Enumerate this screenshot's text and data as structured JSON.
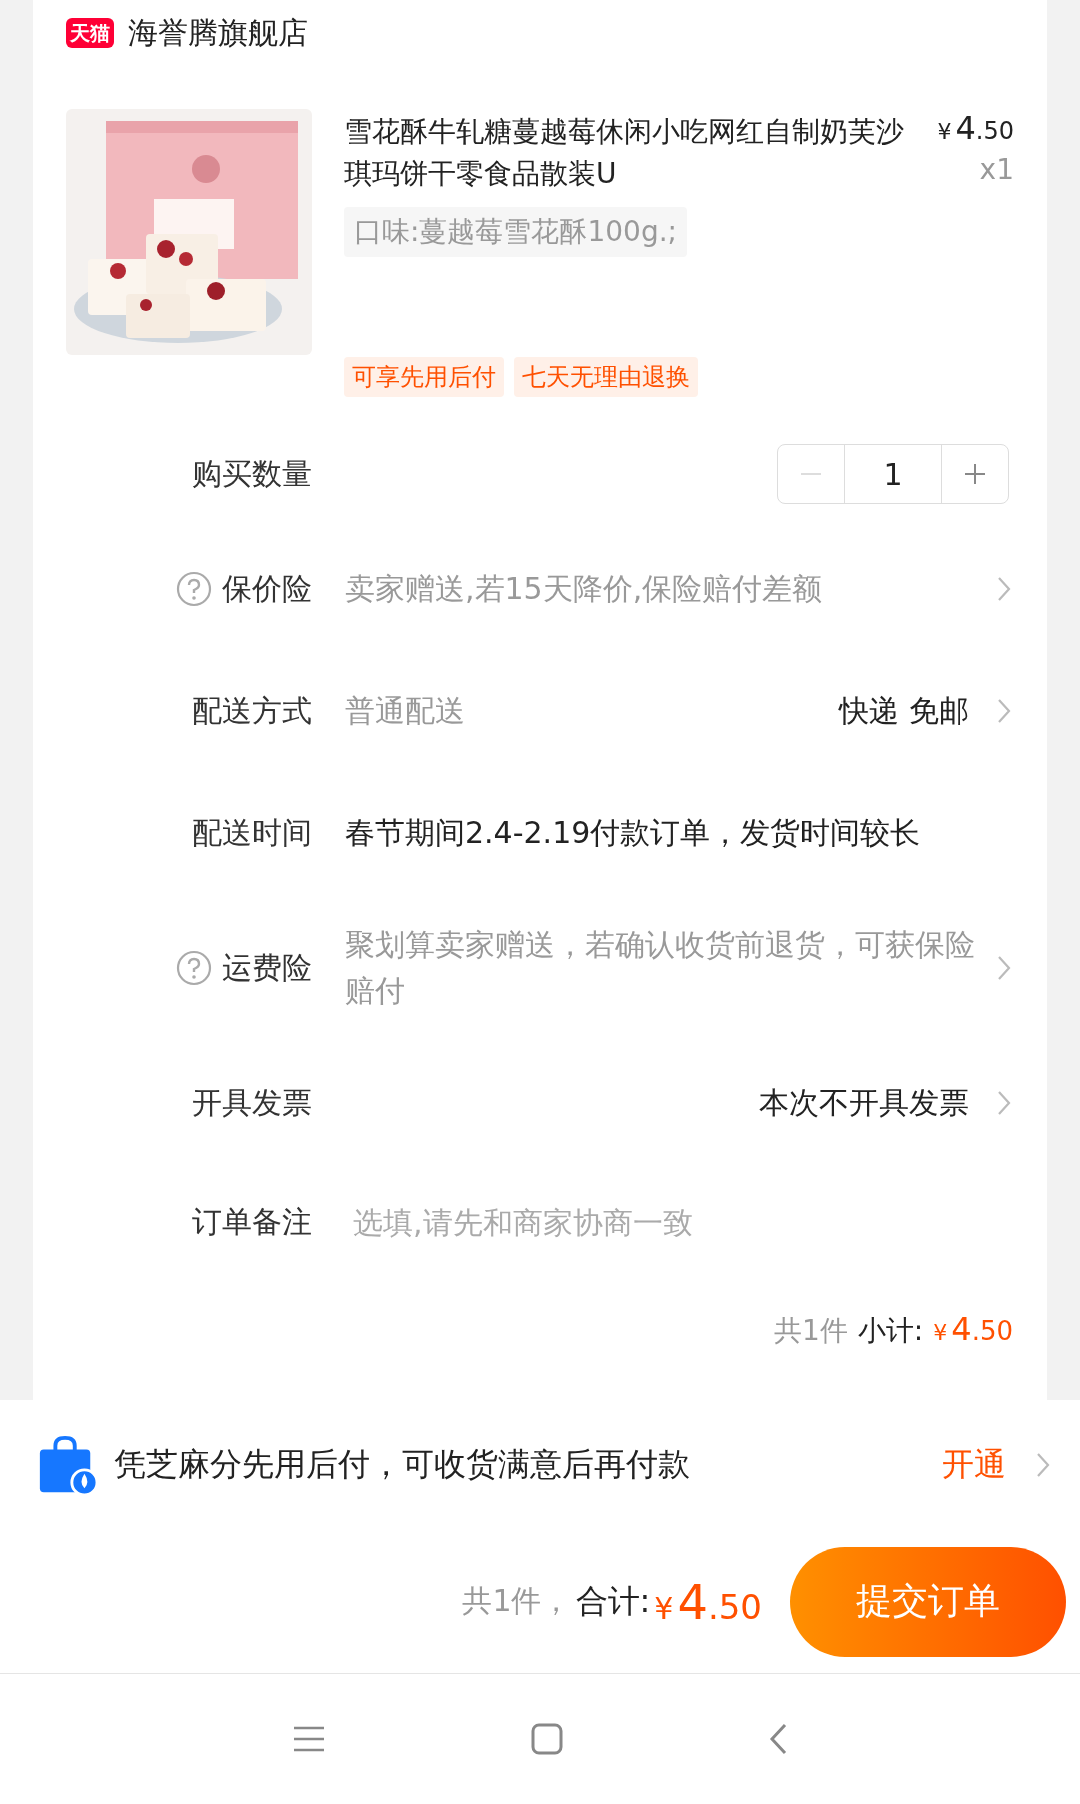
{
  "store": {
    "name": "海誉腾旗舰店",
    "badge": "天猫"
  },
  "product": {
    "title": "雪花酥牛轧糖蔓越莓休闲小吃网红自制奶芙沙琪玛饼干零食品散装U",
    "price": {
      "currency": "¥",
      "integer": "4",
      "decimal": ".50"
    },
    "quantity": "x1",
    "sku": "口味:蔓越莓雪花酥100g.;",
    "tags": [
      "可享先用后付",
      "七天无理由退换"
    ]
  },
  "rows": [
    {
      "kind": "stepper",
      "label": "购买数量",
      "value": "1",
      "decrease_disabled": true
    },
    {
      "kind": "help",
      "label": "保价险",
      "value": "卖家赠送,若15天降价,保险赔付差额"
    },
    {
      "kind": "option",
      "label": "配送方式",
      "value": "普通配送",
      "detail": "快递 免邮"
    },
    {
      "kind": "notice",
      "label": "配送时间",
      "value": "春节期间2.4-2.19付款订单，发货时间较长"
    },
    {
      "kind": "help",
      "label": "运费险",
      "value": "聚划算卖家赠送，若确认收货前退货，可获保险赔付"
    },
    {
      "kind": "option",
      "label": "开具发票",
      "detail": "本次不开具发票"
    },
    {
      "kind": "input",
      "label": "订单备注",
      "placeholder": "选填,请先和商家协商一致"
    }
  ],
  "subtotal": {
    "count": "共1件",
    "label": "小计:",
    "price": {
      "currency": "¥",
      "integer": "4",
      "decimal": ".50"
    }
  },
  "promo": {
    "text": "凭芝麻分先用后付，可收货满意后再付款",
    "action": "开通"
  },
  "footer": {
    "count": "共1件，",
    "label": "合计:",
    "price": {
      "currency": "¥",
      "integer": "4",
      "decimal": ".50"
    },
    "button": "提交订单"
  }
}
